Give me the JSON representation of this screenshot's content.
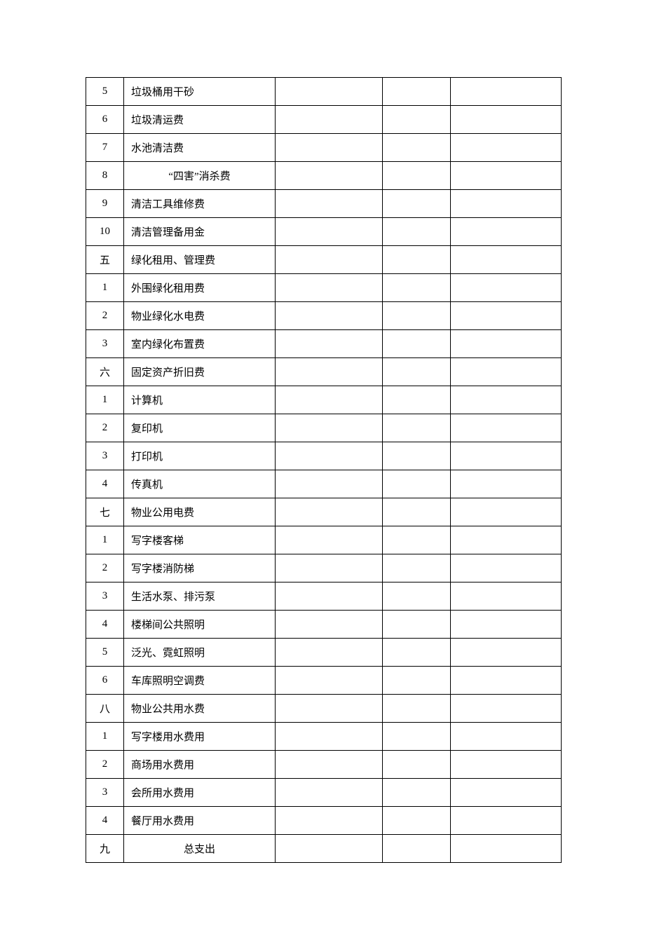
{
  "rows": [
    {
      "num": "5",
      "num_cn": false,
      "name": "垃圾桶用干砂",
      "center": false
    },
    {
      "num": "6",
      "num_cn": false,
      "name": "垃圾清运费",
      "center": false
    },
    {
      "num": "7",
      "num_cn": false,
      "name": "水池清洁费",
      "center": false
    },
    {
      "num": "8",
      "num_cn": false,
      "name": "“四害”消杀费",
      "center": true
    },
    {
      "num": "9",
      "num_cn": false,
      "name": "清洁工具维修费",
      "center": false
    },
    {
      "num": "10",
      "num_cn": false,
      "name": "清洁管理备用金",
      "center": false
    },
    {
      "num": "五",
      "num_cn": true,
      "name": "绿化租用、管理费",
      "center": false
    },
    {
      "num": "1",
      "num_cn": false,
      "name": "外围绿化租用费",
      "center": false
    },
    {
      "num": "2",
      "num_cn": false,
      "name": "物业绿化水电费",
      "center": false
    },
    {
      "num": "3",
      "num_cn": false,
      "name": "室内绿化布置费",
      "center": false
    },
    {
      "num": "六",
      "num_cn": true,
      "name": "固定资产折旧费",
      "center": false
    },
    {
      "num": "1",
      "num_cn": false,
      "name": "计算机",
      "center": false
    },
    {
      "num": "2",
      "num_cn": false,
      "name": "复印机",
      "center": false
    },
    {
      "num": "3",
      "num_cn": false,
      "name": "打印机",
      "center": false
    },
    {
      "num": "4",
      "num_cn": false,
      "name": "传真机",
      "center": false
    },
    {
      "num": "七",
      "num_cn": true,
      "name": "物业公用电费",
      "center": false
    },
    {
      "num": "1",
      "num_cn": false,
      "name": "写字楼客梯",
      "center": false
    },
    {
      "num": "2",
      "num_cn": false,
      "name": "写字楼消防梯",
      "center": false
    },
    {
      "num": "3",
      "num_cn": false,
      "name": "生活水泵、排污泵",
      "center": false
    },
    {
      "num": "4",
      "num_cn": false,
      "name": "楼梯间公共照明",
      "center": false
    },
    {
      "num": "5",
      "num_cn": false,
      "name": "泛光、霓虹照明",
      "center": false
    },
    {
      "num": "6",
      "num_cn": false,
      "name": "车库照明空调费",
      "center": false
    },
    {
      "num": "八",
      "num_cn": true,
      "name": "物业公共用水费",
      "center": false
    },
    {
      "num": "1",
      "num_cn": false,
      "name": "写字楼用水费用",
      "center": false
    },
    {
      "num": "2",
      "num_cn": false,
      "name": "商场用水费用",
      "center": false
    },
    {
      "num": "3",
      "num_cn": false,
      "name": "会所用水费用",
      "center": false
    },
    {
      "num": "4",
      "num_cn": false,
      "name": "餐厅用水费用",
      "center": false
    },
    {
      "num": "九",
      "num_cn": true,
      "name": "总支出",
      "center": true
    }
  ]
}
